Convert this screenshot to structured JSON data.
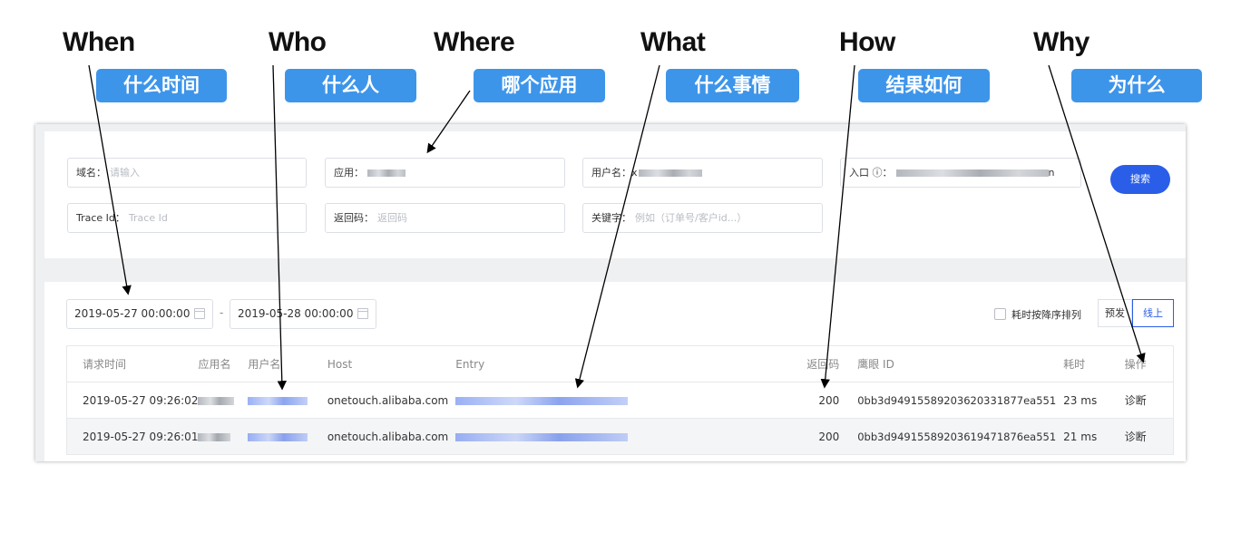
{
  "annotations": [
    {
      "word": "When",
      "tag": "什么时间"
    },
    {
      "word": "Who",
      "tag": "什么人"
    },
    {
      "word": "Where",
      "tag": "哪个应用"
    },
    {
      "word": "What",
      "tag": "什么事情"
    },
    {
      "word": "How",
      "tag": "结果如何"
    },
    {
      "word": "Why",
      "tag": "为什么"
    }
  ],
  "filters": {
    "domain": {
      "label": "域名：",
      "placeholder": "请输入"
    },
    "app": {
      "label": "应用："
    },
    "username": {
      "label": "用户名：",
      "value_prefix": "x"
    },
    "entry": {
      "label": "入口 ⓘ：",
      "value_suffix": "n"
    },
    "trace": {
      "label": "Trace Id：",
      "placeholder": "Trace Id"
    },
    "return_code": {
      "label": "返回码：",
      "placeholder": "返回码"
    },
    "keyword": {
      "label": "关键字：",
      "placeholder": "例如（订单号/客户id...）"
    },
    "search_label": "搜索"
  },
  "toolbar": {
    "date_start": "2019-05-27 00:00:00",
    "date_separator": "-",
    "date_end": "2019-05-28 00:00:00",
    "sort_label": "耗时按降序排列",
    "env_pre": "预发",
    "env_online": "线上"
  },
  "table": {
    "columns": [
      "请求时间",
      "应用名",
      "用户名",
      "Host",
      "Entry",
      "返回码",
      "鹰眼 ID",
      "耗时",
      "操作"
    ],
    "rows": [
      {
        "time": "2019-05-27 09:26:02",
        "host": "onetouch.alibaba.com",
        "code": "200",
        "trace_id": "0bb3d94915589203620331877ea551",
        "cost": "23 ms",
        "action": "诊断"
      },
      {
        "time": "2019-05-27 09:26:01",
        "host": "onetouch.alibaba.com",
        "code": "200",
        "trace_id": "0bb3d94915589203619471876ea551",
        "cost": "21 ms",
        "action": "诊断"
      }
    ]
  },
  "colors": {
    "accent": "#2a5ee8",
    "tag_bg": "#3d95ea"
  }
}
